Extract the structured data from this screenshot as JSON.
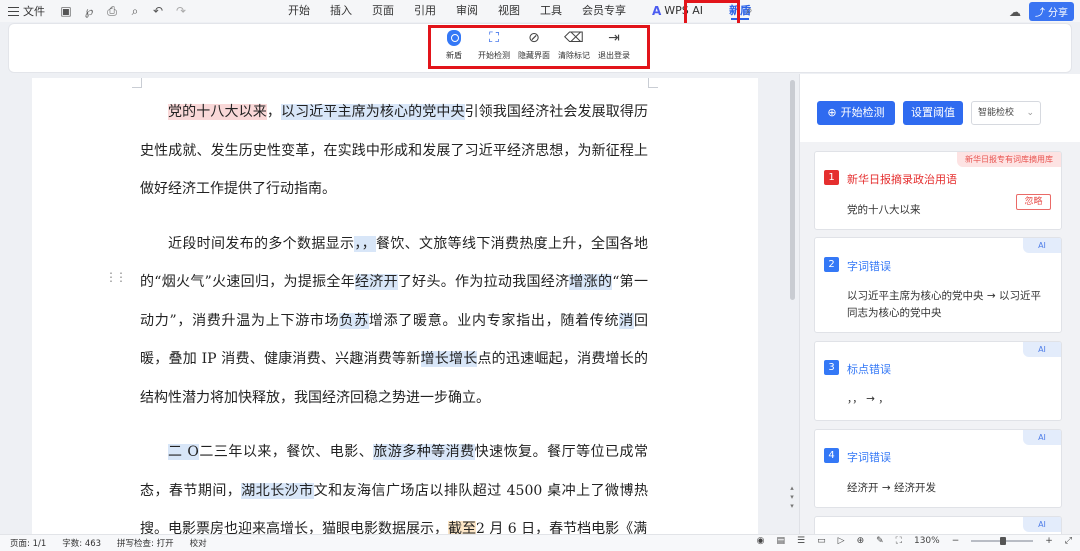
{
  "menubar": {
    "file_label": "文件",
    "quick_access_icons": [
      "save-icon",
      "export-icon",
      "print-icon",
      "print-preview-icon",
      "undo-icon",
      "redo-icon"
    ],
    "tabs": [
      "开始",
      "插入",
      "页面",
      "引用",
      "审阅",
      "视图",
      "工具",
      "会员专享"
    ],
    "wps_ai_label": "WPS AI",
    "active_tab": "新盾",
    "share_label": "分享"
  },
  "ribbon": {
    "items": [
      {
        "label": "新盾",
        "icon": "shield-icon"
      },
      {
        "label": "开始检测",
        "icon": "scan-search-icon"
      },
      {
        "label": "隐藏界面",
        "icon": "eye-off-icon"
      },
      {
        "label": "清除标记",
        "icon": "eraser-icon"
      },
      {
        "label": "退出登录",
        "icon": "logout-icon"
      }
    ]
  },
  "document": {
    "p1": {
      "a": "党的十八大以来",
      "b": "，",
      "c": "以习近平主席为核心的党中央",
      "d": "引领我国经济社会发展取得历史性成就、发生历史性变革，在实践中形成和发展了习近平经济思想，为新征程上做好经济工作提供了行动指南。"
    },
    "p2": {
      "a": "近段时间发布的多个数据显示",
      "b": "，，",
      "c": "餐饮、文旅等线下消费热度上升，全国各地的“烟火气”火速回归，为提振全年",
      "d": "经济开",
      "e": "了好头。作为拉动我国经济",
      "f": "增涨的",
      "g": "“第一动力”，消费升温为上下游市场",
      "h": "负苏",
      "i": "增添了暖意。业内专家指出，随着传统",
      "j": "消",
      "k": "回暖，叠加 IP 消费、健康消费、兴趣消费等新",
      "l": "增长增长",
      "m": "点的迅速崛起，消费增长的结构性潜力将加快释放，我国经济回稳之势进一步确立。"
    },
    "p3": {
      "a": "二 O",
      "b": "二三年以来，餐饮、电影、",
      "c": "旅游多种等消费",
      "d": "快速恢复。餐厅等位已成常态，春节期间，",
      "e": "湖北长沙市",
      "f": "文和友海信广场店以排队超过 4500 桌冲上了微博热搜。电影票房也迎来高增长，猫眼电影数据展示，",
      "g": "截至",
      "h": "2 月 6 日，春节档电影《满"
    }
  },
  "panel": {
    "start_label": "开始检测",
    "threshold_label": "设置阈值",
    "select_value": "智能检校",
    "cards": [
      {
        "num": "1",
        "title": "新华日报摘录政治用语",
        "body": "党的十八大以来",
        "tag": "新华日报专有词库摘用库",
        "ignore": "忽略"
      },
      {
        "num": "2",
        "title": "字词错误",
        "body": "以习近平主席为核心的党中央 → 以习近平同志为核心的党中央",
        "tag": "AI"
      },
      {
        "num": "3",
        "title": "标点错误",
        "body": "，，  →  ，",
        "tag": "AI"
      },
      {
        "num": "4",
        "title": "字词错误",
        "body": "经济开 → 经济开发",
        "tag": "AI"
      },
      {
        "tag": "AI"
      }
    ]
  },
  "statusbar": {
    "page": "页面: 1/1",
    "words": "字数: 463",
    "spellcheck": "拼写检查: 打开",
    "proofread": "校对",
    "zoom": "130%",
    "zoom_fraction": 0.46
  }
}
